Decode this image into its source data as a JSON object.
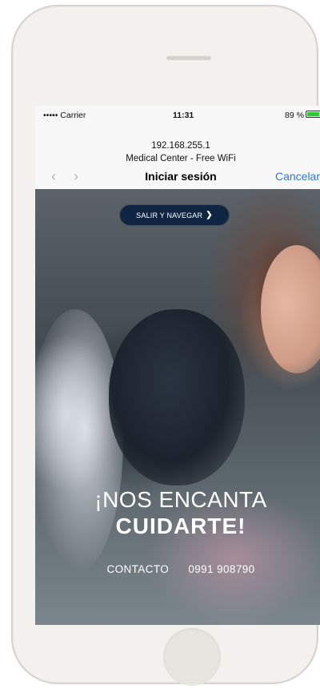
{
  "status_bar": {
    "carrier": "••••• Carrier",
    "time": "11:31",
    "battery": "89 %",
    "battery_color": "#35c53a"
  },
  "address": {
    "ip": "192.168.255.1",
    "network": "Medical Center - Free WiFi"
  },
  "nav": {
    "back_icon": "chevron-left",
    "forward_icon": "chevron-right",
    "title": "Iniciar sesión",
    "cancel": "Cancelar",
    "accent": "#2f79d8"
  },
  "hero": {
    "cta": "SALIR Y NAVEGAR",
    "cta_icon": "chevron-right",
    "cta_color": "#0f2542",
    "headline_1": "¡NOS ENCANTA",
    "headline_2": "CUIDARTE!",
    "contact_label": "CONTACTO",
    "contact_phone": "0991 908790"
  }
}
